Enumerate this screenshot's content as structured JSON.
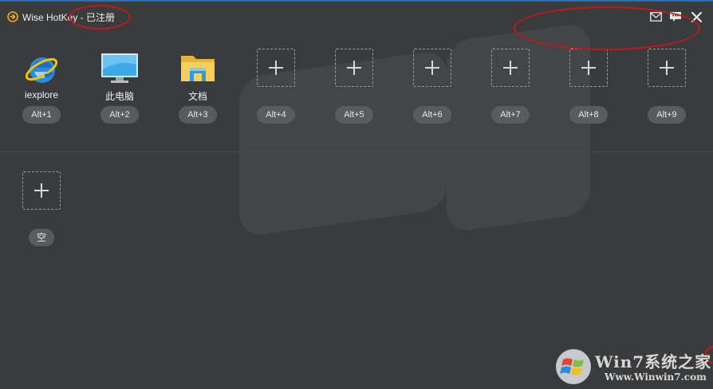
{
  "window": {
    "title": "Wise HotKey",
    "title_suffix": " - 已注册"
  },
  "toolbar": {
    "mail_icon": "mail-icon",
    "feedback_icon": "chat-icon",
    "close_icon": "close-icon"
  },
  "hotkeys": [
    {
      "label": "iexplore",
      "shortcut": "Alt+1",
      "icon": "internet-explorer-icon"
    },
    {
      "label": "此电脑",
      "shortcut": "Alt+2",
      "icon": "computer-monitor-icon"
    },
    {
      "label": "文档",
      "shortcut": "Alt+3",
      "icon": "folder-icon"
    },
    {
      "label": "",
      "shortcut": "Alt+4",
      "icon": "plus-icon"
    },
    {
      "label": "",
      "shortcut": "Alt+5",
      "icon": "plus-icon"
    },
    {
      "label": "",
      "shortcut": "Alt+6",
      "icon": "plus-icon"
    },
    {
      "label": "",
      "shortcut": "Alt+7",
      "icon": "plus-icon"
    },
    {
      "label": "",
      "shortcut": "Alt+8",
      "icon": "plus-icon"
    },
    {
      "label": "",
      "shortcut": "Alt+9",
      "icon": "plus-icon"
    }
  ],
  "second_row": {
    "shortcut": "空",
    "icon": "plus-icon"
  },
  "watermark": {
    "brand": "Win7系统之家",
    "url": "Www.Winwin7.com"
  },
  "colors": {
    "background": "#3a3b3d",
    "pill": "#5a5b5d",
    "annotation": "#c4161c",
    "accent": "#f5a623"
  }
}
